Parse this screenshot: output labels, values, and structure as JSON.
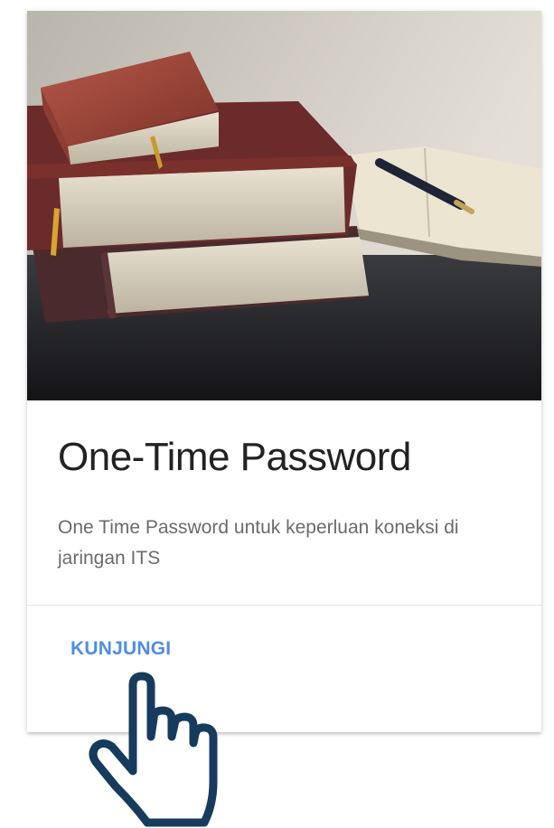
{
  "card": {
    "title": "One-Time Password",
    "description": "One Time Password untuk keperluan koneksi di jaringan ITS",
    "action_label": "KUNJUNGI",
    "image_icon": "books-and-pen-photo"
  },
  "cursor": {
    "icon": "pointing-hand-icon"
  },
  "colors": {
    "action": "#4f8de8",
    "title": "#222222",
    "description": "#6b6b6b",
    "cursor_stroke": "#163b5c"
  }
}
